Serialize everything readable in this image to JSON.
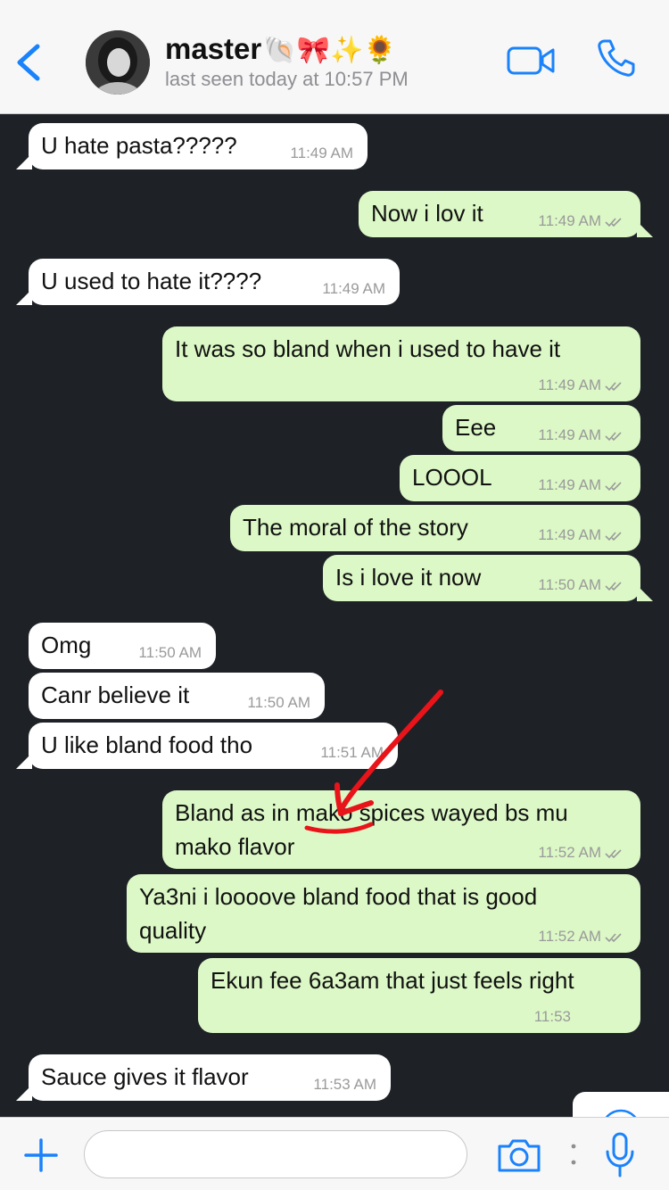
{
  "header": {
    "name": "master",
    "name_emojis": "🐚🎀✨🌻",
    "status": "last seen today at 10:57 PM"
  },
  "messages": [
    {
      "dir": "in",
      "text": "U hate pasta?????",
      "time": "11:49 AM"
    },
    {
      "dir": "out",
      "text": "Now i lov it",
      "time": "11:49 AM",
      "read": true
    },
    {
      "dir": "in",
      "text": "U used to hate it????",
      "time": "11:49 AM"
    },
    {
      "dir": "out",
      "text": "It was so bland when i used to have it",
      "time": "11:49 AM",
      "read": true
    },
    {
      "dir": "out",
      "text": "Eee",
      "time": "11:49 AM",
      "read": true
    },
    {
      "dir": "out",
      "text": "LOOOL",
      "time": "11:49 AM",
      "read": true
    },
    {
      "dir": "out",
      "text": "The moral of the story",
      "time": "11:49 AM",
      "read": true
    },
    {
      "dir": "out",
      "text": "Is i love it now",
      "time": "11:50 AM",
      "read": true
    },
    {
      "dir": "in",
      "text": "Omg",
      "time": "11:50 AM"
    },
    {
      "dir": "in",
      "text": "Canr believe it",
      "time": "11:50 AM"
    },
    {
      "dir": "in",
      "text": "U like bland food tho",
      "time": "11:51 AM"
    },
    {
      "dir": "out",
      "lines": [
        "Bland as in mako spices wayed bs mu",
        "mako flavor"
      ],
      "time": "11:52 AM",
      "read": true
    },
    {
      "dir": "out",
      "lines": [
        "Ya3ni i loooove bland food that is good",
        "quality"
      ],
      "time": "11:52 AM",
      "read": true
    },
    {
      "dir": "out",
      "text": "Ekun fee 6a3am that just feels right",
      "time": "11:53",
      "read": true
    },
    {
      "dir": "in",
      "text": "Sauce gives it flavor",
      "time": "11:53 AM"
    }
  ],
  "input": {
    "placeholder": ""
  },
  "colors": {
    "accent": "#1a82fb",
    "chat_background": "#1e2227",
    "incoming_bubble": "#ffffff",
    "outgoing_bubble": "#dcf8c6",
    "annotation": "#e8141a"
  }
}
